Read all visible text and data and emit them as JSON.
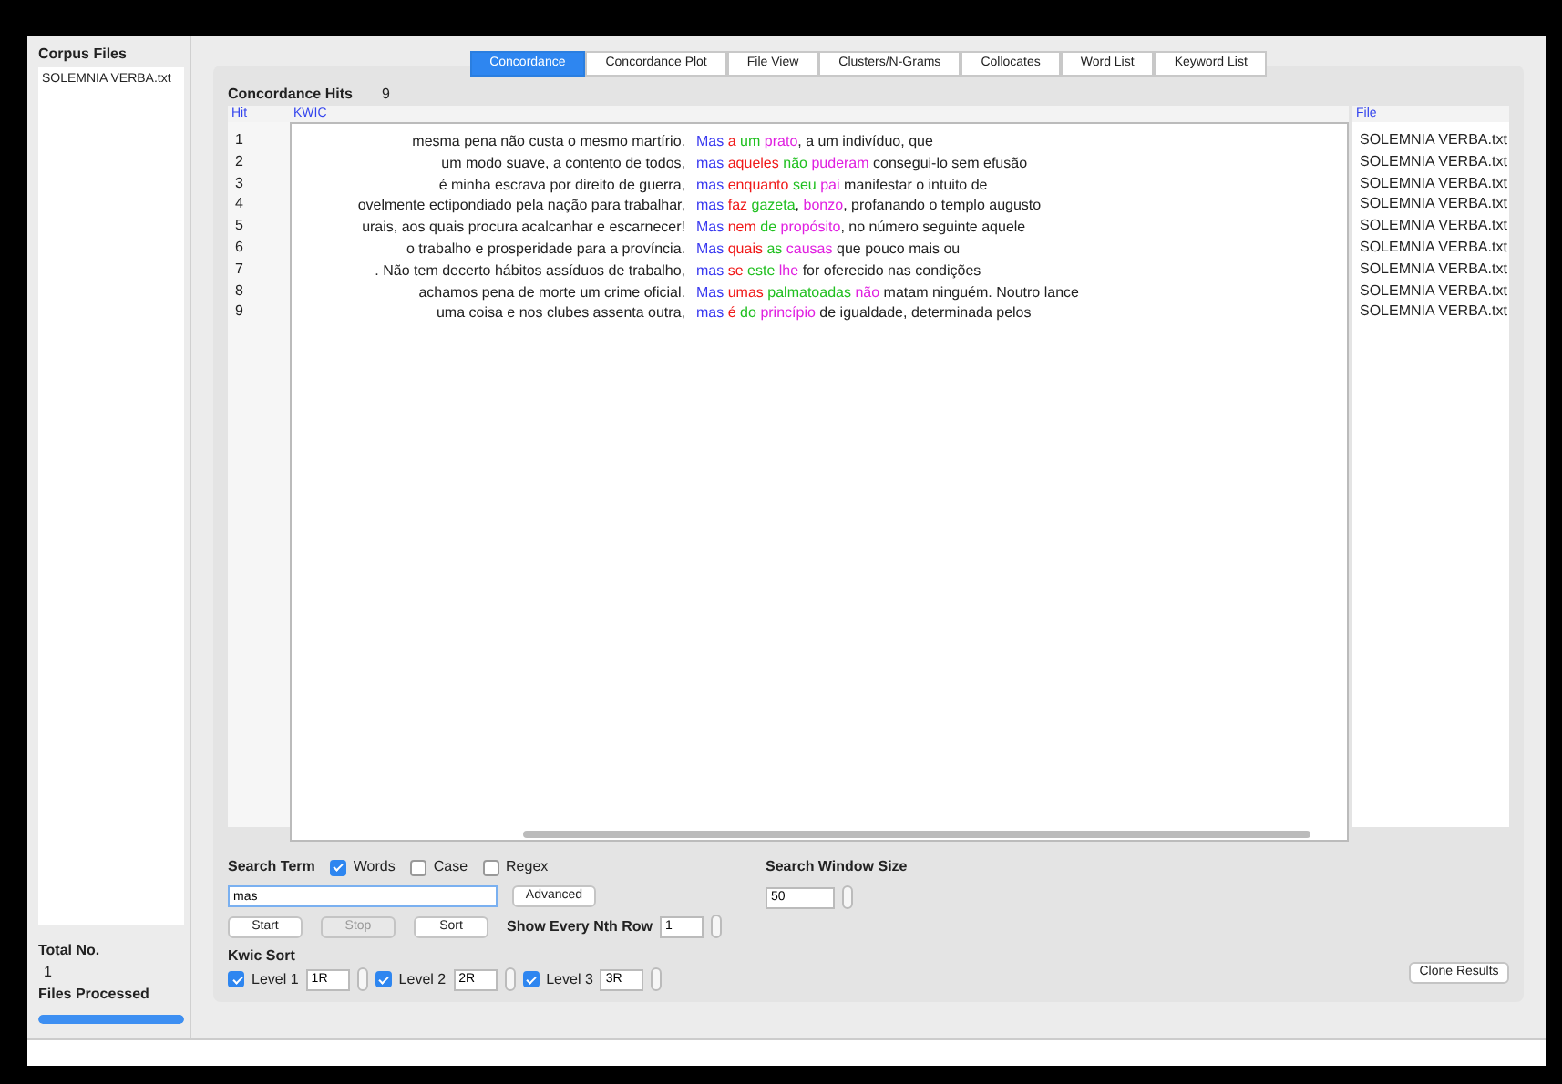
{
  "sidebar": {
    "title": "Corpus Files",
    "files": [
      {
        "name": "SOLEMNIA VERBA.txt",
        "selected": false
      }
    ],
    "total_label": "Total No.",
    "total": "1",
    "processed_label": "Files Processed",
    "progress": {
      "level": 1
    }
  },
  "tabs": [
    {
      "label": "Concordance",
      "selected": true
    },
    {
      "label": "Concordance Plot",
      "selected": false
    },
    {
      "label": "File View",
      "selected": false
    },
    {
      "label": "Clusters/N-Grams",
      "selected": false
    },
    {
      "label": "Collocates",
      "selected": false
    },
    {
      "label": "Word List",
      "selected": false
    },
    {
      "label": "Keyword List",
      "selected": false
    }
  ],
  "hits": {
    "label": "Concordance Hits",
    "count": "9"
  },
  "table": {
    "columns": [
      "Hit",
      "KWIC",
      "File"
    ],
    "rows": [
      {
        "hit": "1",
        "left": "mesma pena não custa o mesmo martírio.",
        "right": [
          {
            "kind": "node",
            "text": "Mas"
          },
          {
            "kind": "r1",
            "text": "a"
          },
          {
            "kind": "r2",
            "text": "um"
          },
          {
            "kind": "r3",
            "text": "prato"
          },
          {
            "kind": "plain",
            "text": ", a um indivíduo, que",
            "joined": true
          }
        ],
        "file": "SOLEMNIA VERBA.txt"
      },
      {
        "hit": "2",
        "left": "um modo suave, a contento de todos,",
        "right": [
          {
            "kind": "node",
            "text": "mas"
          },
          {
            "kind": "r1",
            "text": "aqueles"
          },
          {
            "kind": "r2",
            "text": "não"
          },
          {
            "kind": "r3",
            "text": "puderam"
          },
          {
            "kind": "plain",
            "text": "consegui-lo sem efusão",
            "joined": false
          }
        ],
        "file": "SOLEMNIA VERBA.txt"
      },
      {
        "hit": "3",
        "left": "é minha escrava por direito de guerra,",
        "right": [
          {
            "kind": "node",
            "text": "mas"
          },
          {
            "kind": "r1",
            "text": "enquanto"
          },
          {
            "kind": "r2",
            "text": "seu"
          },
          {
            "kind": "r3",
            "text": "pai"
          },
          {
            "kind": "plain",
            "text": "manifestar o intuito de",
            "joined": false
          }
        ],
        "file": "SOLEMNIA VERBA.txt"
      },
      {
        "hit": "4",
        "left": "ovelmente ectipondiado pela nação para trabalhar,",
        "right": [
          {
            "kind": "node",
            "text": "mas"
          },
          {
            "kind": "r1",
            "text": "faz"
          },
          {
            "kind": "r2",
            "text": "gazeta"
          },
          {
            "kind": "plain",
            "text": ",",
            "joined": true
          },
          {
            "kind": "r3",
            "text": "bonzo"
          },
          {
            "kind": "plain",
            "text": ", profanando o templo augusto",
            "joined": true
          }
        ],
        "file": "SOLEMNIA VERBA.txt"
      },
      {
        "hit": "5",
        "left": "urais, aos quais procura acalcanhar e escarnecer!",
        "right": [
          {
            "kind": "node",
            "text": "Mas"
          },
          {
            "kind": "r1",
            "text": "nem"
          },
          {
            "kind": "r2",
            "text": "de"
          },
          {
            "kind": "r3",
            "text": "propósito"
          },
          {
            "kind": "plain",
            "text": ", no número seguinte aquele",
            "joined": true
          }
        ],
        "file": "SOLEMNIA VERBA.txt"
      },
      {
        "hit": "6",
        "left": "o trabalho e prosperidade para a província.",
        "right": [
          {
            "kind": "node",
            "text": "Mas"
          },
          {
            "kind": "r1",
            "text": "quais"
          },
          {
            "kind": "r2",
            "text": "as"
          },
          {
            "kind": "r3",
            "text": "causas"
          },
          {
            "kind": "plain",
            "text": "que pouco mais ou",
            "joined": false
          }
        ],
        "file": "SOLEMNIA VERBA.txt"
      },
      {
        "hit": "7",
        "left": ". Não tem decerto hábitos assíduos de trabalho,",
        "right": [
          {
            "kind": "node",
            "text": "mas"
          },
          {
            "kind": "r1",
            "text": "se"
          },
          {
            "kind": "r2",
            "text": "este"
          },
          {
            "kind": "r3",
            "text": "lhe"
          },
          {
            "kind": "plain",
            "text": "for oferecido nas condições",
            "joined": false
          }
        ],
        "file": "SOLEMNIA VERBA.txt"
      },
      {
        "hit": "8",
        "left": "achamos pena de morte um crime oficial.",
        "right": [
          {
            "kind": "node",
            "text": "Mas"
          },
          {
            "kind": "r1",
            "text": "umas"
          },
          {
            "kind": "r2",
            "text": "palmatoadas"
          },
          {
            "kind": "r3",
            "text": "não"
          },
          {
            "kind": "plain",
            "text": "matam ninguém. Noutro lance",
            "joined": false
          }
        ],
        "file": "SOLEMNIA VERBA.txt"
      },
      {
        "hit": "9",
        "left": "uma coisa e nos clubes assenta outra,",
        "right": [
          {
            "kind": "node",
            "text": "mas"
          },
          {
            "kind": "r1",
            "text": "é"
          },
          {
            "kind": "r2",
            "text": "do"
          },
          {
            "kind": "r3",
            "text": "princípio"
          },
          {
            "kind": "plain",
            "text": "de igualdade, determinada pelos",
            "joined": false
          }
        ],
        "file": "SOLEMNIA VERBA.txt"
      }
    ]
  },
  "search": {
    "label": "Search Term",
    "options": [
      {
        "label": "Words",
        "checked": true
      },
      {
        "label": "Case",
        "checked": false
      },
      {
        "label": "Regex",
        "checked": false
      }
    ],
    "value": "mas",
    "advanced": "Advanced",
    "window_label": "Search Window Size",
    "window_size": "50"
  },
  "buttons": [
    {
      "label": "Start",
      "disabled": false
    },
    {
      "label": "Stop",
      "disabled": true
    },
    {
      "label": "Sort",
      "disabled": false
    }
  ],
  "nth_row": {
    "label": "Show Every Nth Row",
    "value": "1"
  },
  "kwic_sort": {
    "label": "Kwic Sort",
    "levels": [
      {
        "label": "Level 1",
        "checked": true,
        "value": "1R"
      },
      {
        "label": "Level 2",
        "checked": true,
        "value": "2R"
      },
      {
        "label": "Level 3",
        "checked": true,
        "value": "3R"
      }
    ]
  },
  "clone_button": "Clone Results"
}
